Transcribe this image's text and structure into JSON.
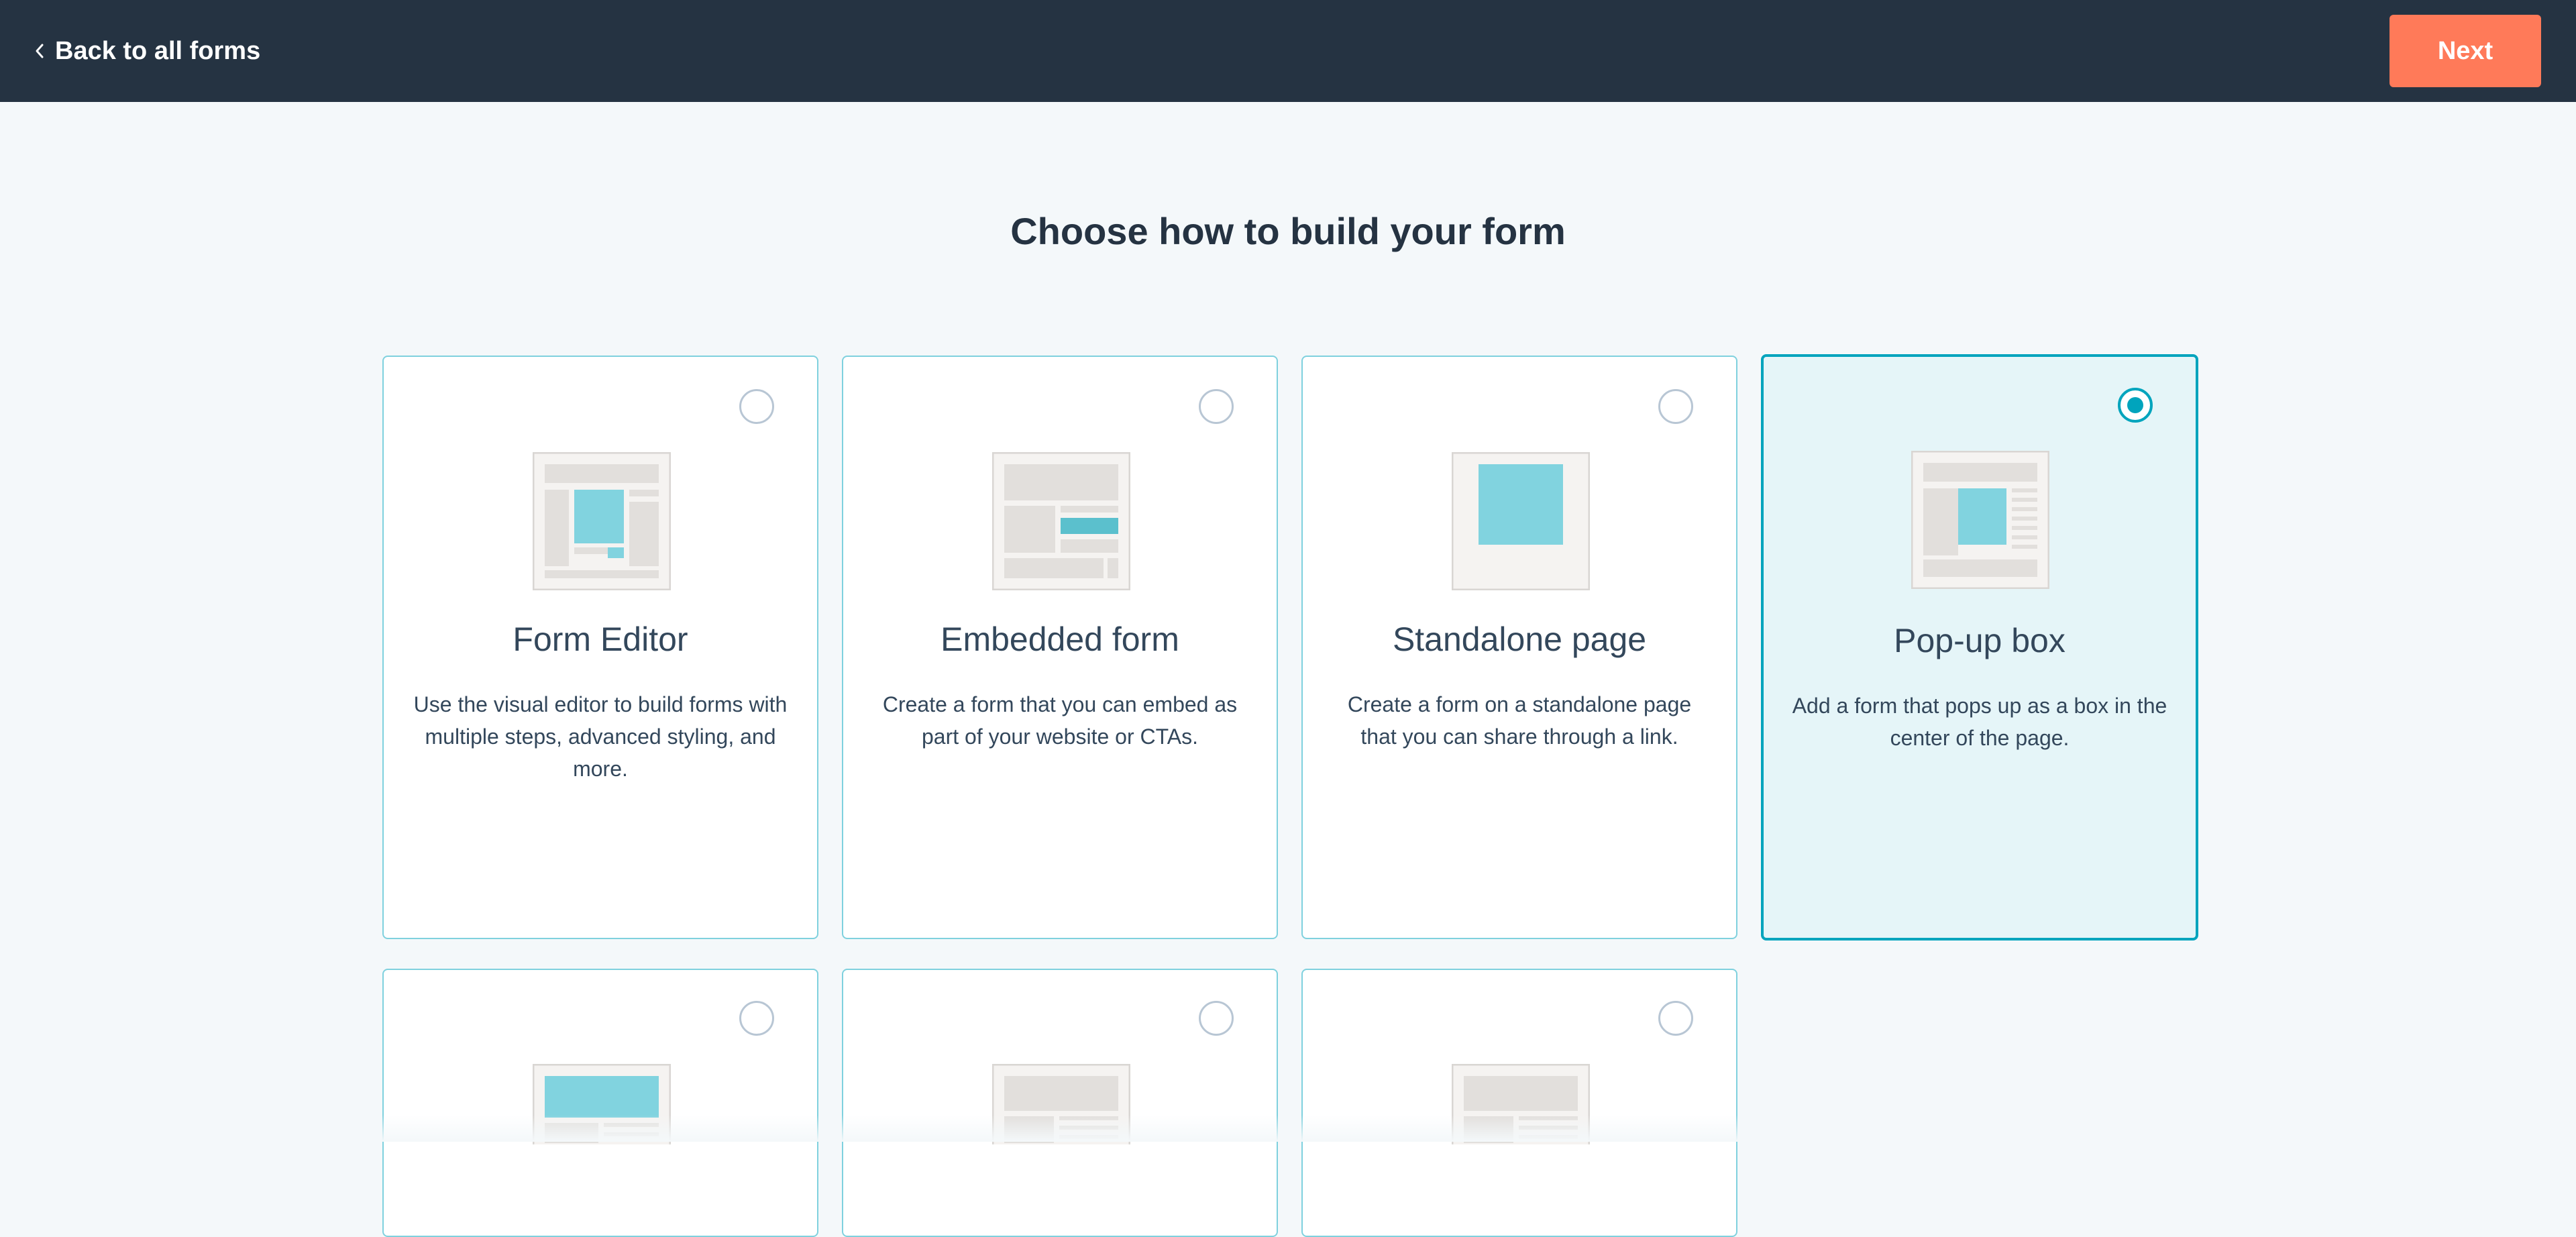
{
  "header": {
    "back_label": "Back to all forms",
    "next_label": "Next"
  },
  "page": {
    "title": "Choose how to build your form"
  },
  "options": [
    {
      "title": "Form Editor",
      "description": "Use the visual editor to build forms with multiple steps, advanced styling, and more.",
      "selected": false,
      "icon": "form-editor-icon"
    },
    {
      "title": "Embedded form",
      "description": "Create a form that you can embed as part of your website or CTAs.",
      "selected": false,
      "icon": "embedded-form-icon"
    },
    {
      "title": "Standalone page",
      "description": "Create a form on a standalone page that you can share through a link.",
      "selected": false,
      "icon": "standalone-page-icon"
    },
    {
      "title": "Pop-up box",
      "description": "Add a form that pops up as a box in the center of the page.",
      "selected": true,
      "icon": "popup-box-icon"
    },
    {
      "title": "",
      "description": "",
      "selected": false,
      "icon": "banner-icon"
    },
    {
      "title": "",
      "description": "",
      "selected": false,
      "icon": "slide-in-icon"
    },
    {
      "title": "",
      "description": "",
      "selected": false,
      "icon": "page-layout-icon"
    }
  ],
  "colors": {
    "header_bg": "#253342",
    "accent": "#ff7a59",
    "selected": "#00a4bd",
    "illustration": "#81d3df"
  }
}
